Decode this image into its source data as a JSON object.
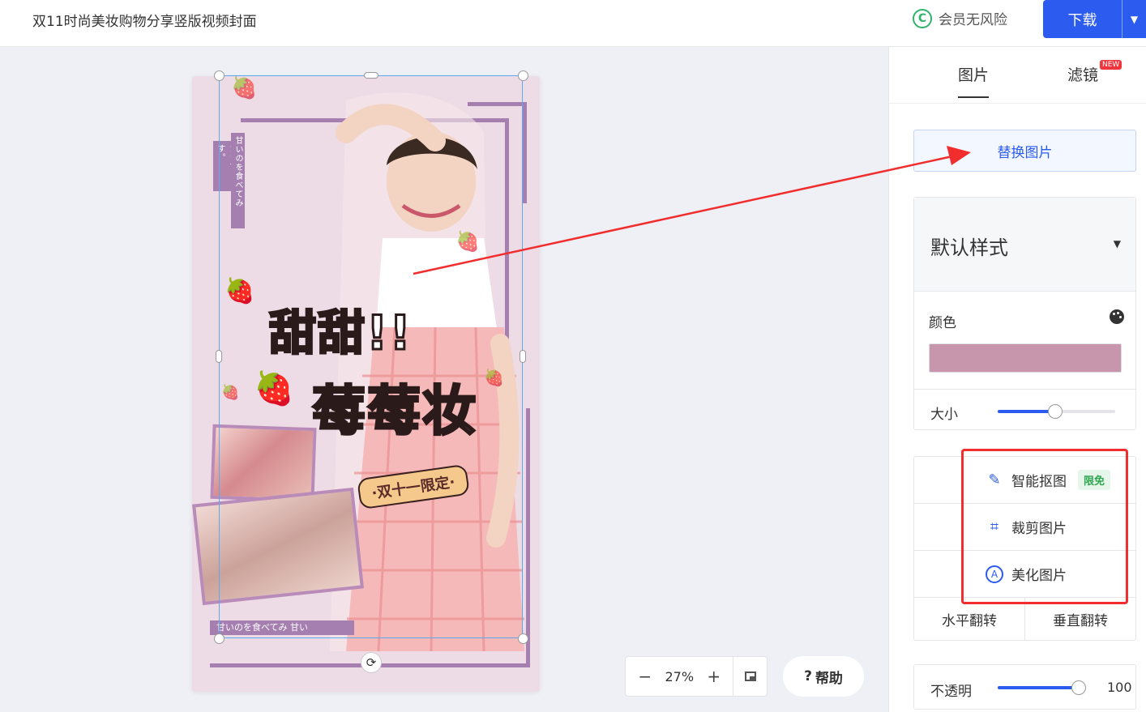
{
  "header": {
    "title": "双11时尚美妆购物分享竖版视频封面",
    "member_text": "会员无风险",
    "member_icon": "C",
    "download_label": "下载"
  },
  "poster": {
    "side_text_1": "たいです。",
    "side_text_2": "甘いのを食べてみ",
    "headline_1": "甜甜!!",
    "headline_2": "莓莓妆",
    "badge": "·双十一限定·",
    "bottom_strip": "甘いのを食べてみ 甘い"
  },
  "zoom": {
    "minus": "−",
    "value": "27%",
    "plus": "+"
  },
  "help": {
    "label": "帮助",
    "icon": "?"
  },
  "panel": {
    "tabs": [
      {
        "label": "图片"
      },
      {
        "label": "滤镜",
        "badge": "NEW"
      }
    ],
    "replace_button": "替换图片",
    "style_select": "默认样式",
    "color_label": "颜色",
    "color_value": "#c796ac",
    "size_label": "大小",
    "size_percent": 49,
    "tools": [
      {
        "label": "智能抠图",
        "icon": "magic-wand-icon",
        "badge": "限免"
      },
      {
        "label": "裁剪图片",
        "icon": "crop-icon"
      },
      {
        "label": "美化图片",
        "icon": "beautify-icon"
      }
    ],
    "flip": {
      "horizontal": "水平翻转",
      "vertical": "垂直翻转"
    },
    "opacity_label": "不透明",
    "opacity_value": "100",
    "opacity_percent": 100
  },
  "colors": {
    "accent": "#2b5bef",
    "highlight": "#f12d2d"
  }
}
